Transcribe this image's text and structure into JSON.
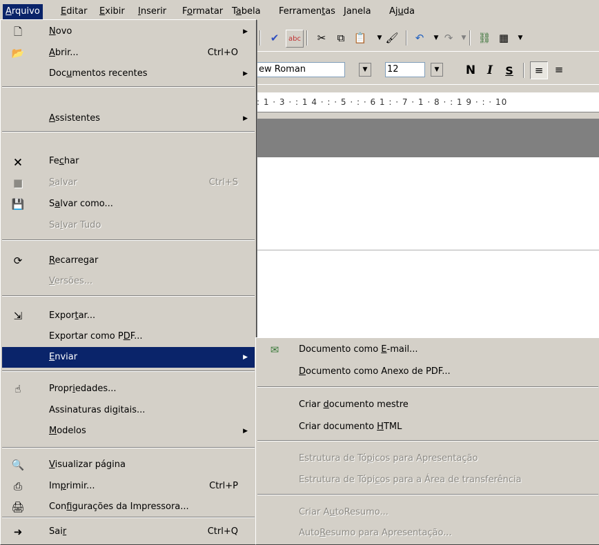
{
  "menubar": [
    {
      "label": "Arquivo",
      "key": "A",
      "active": true
    },
    {
      "label": "Editar",
      "key": "E"
    },
    {
      "label": "Exibir",
      "key": "E"
    },
    {
      "label": "Inserir",
      "key": "I"
    },
    {
      "label": "Formatar",
      "key": "o"
    },
    {
      "label": "Tabela",
      "key": "a"
    },
    {
      "label": "Ferramentas",
      "key": "t"
    },
    {
      "label": "Janela",
      "key": "J"
    },
    {
      "label": "Ajuda",
      "key": "u"
    }
  ],
  "toolbar": {
    "font_name": "ew Roman",
    "font_size": "12",
    "bold": "N",
    "italic": "I",
    "underline": "S",
    "ruler": ": 1 · 3 · : 1 4 · : · 5 · : · 6 1 : · 7 · 1 · 8 · : 1 9 · : · 10"
  },
  "file_menu": {
    "items": [
      {
        "type": "item",
        "label": "Novo",
        "key": "N",
        "icon": "new-document-icon",
        "submenu": true
      },
      {
        "type": "item",
        "label": "Abrir...",
        "key": "A",
        "shortcut": "Ctrl+O",
        "icon": "open-folder-icon"
      },
      {
        "type": "item",
        "label": "Documentos recentes",
        "key": "u",
        "submenu": true
      },
      {
        "type": "sep"
      },
      {
        "type": "item",
        "label": "Assistentes",
        "key": "A",
        "submenu": true
      },
      {
        "type": "sep"
      },
      {
        "type": "item",
        "label": "Fechar",
        "key": "c",
        "icon": "close-document-icon"
      },
      {
        "type": "item",
        "label": "Salvar",
        "key": "S",
        "shortcut": "Ctrl+S",
        "icon": "save-disk-icon",
        "disabled": true
      },
      {
        "type": "item",
        "label": "Salvar como...",
        "key": "a",
        "icon": "save-as-icon"
      },
      {
        "type": "item",
        "label": "Salvar Tudo",
        "key": "l",
        "disabled": true
      },
      {
        "type": "sep"
      },
      {
        "type": "item",
        "label": "Recarregar",
        "key": "R",
        "icon": "reload-icon"
      },
      {
        "type": "item",
        "label": "Versões...",
        "key": "V",
        "disabled": true
      },
      {
        "type": "sep"
      },
      {
        "type": "item",
        "label": "Exportar...",
        "key": "t",
        "icon": "export-icon"
      },
      {
        "type": "item",
        "label": "Exportar como PDF...",
        "key": "D"
      },
      {
        "type": "item",
        "label": "Enviar",
        "key": "E",
        "submenu": true,
        "highlighted": true
      },
      {
        "type": "sep"
      },
      {
        "type": "item",
        "label": "Propriedades...",
        "key": "i",
        "icon": "properties-icon"
      },
      {
        "type": "item",
        "label": "Assinaturas digitais...",
        "key": "g"
      },
      {
        "type": "item",
        "label": "Modelos",
        "key": "M",
        "submenu": true
      },
      {
        "type": "sep"
      },
      {
        "type": "item",
        "label": "Visualizar página",
        "key": "V",
        "icon": "page-preview-icon"
      },
      {
        "type": "item",
        "label": "Imprimir...",
        "key": "p",
        "shortcut": "Ctrl+P",
        "icon": "printer-icon"
      },
      {
        "type": "item",
        "label": "Configurações da Impressora...",
        "key": "f",
        "icon": "printer-settings-icon"
      },
      {
        "type": "sep"
      },
      {
        "type": "item",
        "label": "Sair",
        "key": "r",
        "shortcut": "Ctrl+Q",
        "icon": "exit-icon"
      }
    ]
  },
  "send_submenu": {
    "items": [
      {
        "type": "item",
        "label": "Documento como E-mail...",
        "key": "E",
        "icon": "email-envelope-icon"
      },
      {
        "type": "item",
        "label": "Documento como Anexo de PDF...",
        "key": "D"
      },
      {
        "type": "sep"
      },
      {
        "type": "item",
        "label": "Criar documento mestre",
        "key": "d"
      },
      {
        "type": "item",
        "label": "Criar documento HTML",
        "key": "H"
      },
      {
        "type": "sep"
      },
      {
        "type": "item",
        "label": "Estrutura de Tópicos para Apresentação",
        "key": "p",
        "disabled": true
      },
      {
        "type": "item",
        "label": "Estrutura de Tópicos para a Área de transferência",
        "key": "c",
        "disabled": true
      },
      {
        "type": "sep"
      },
      {
        "type": "item",
        "label": "Criar AutoResumo...",
        "key": "u",
        "disabled": true
      },
      {
        "type": "item",
        "label": "AutoResumo para Apresentação...",
        "key": "R",
        "disabled": true
      }
    ]
  },
  "colors": {
    "highlight": "#0a246a",
    "menu_bg": "#d4d0c8",
    "disabled_text": "#8c8a84"
  }
}
